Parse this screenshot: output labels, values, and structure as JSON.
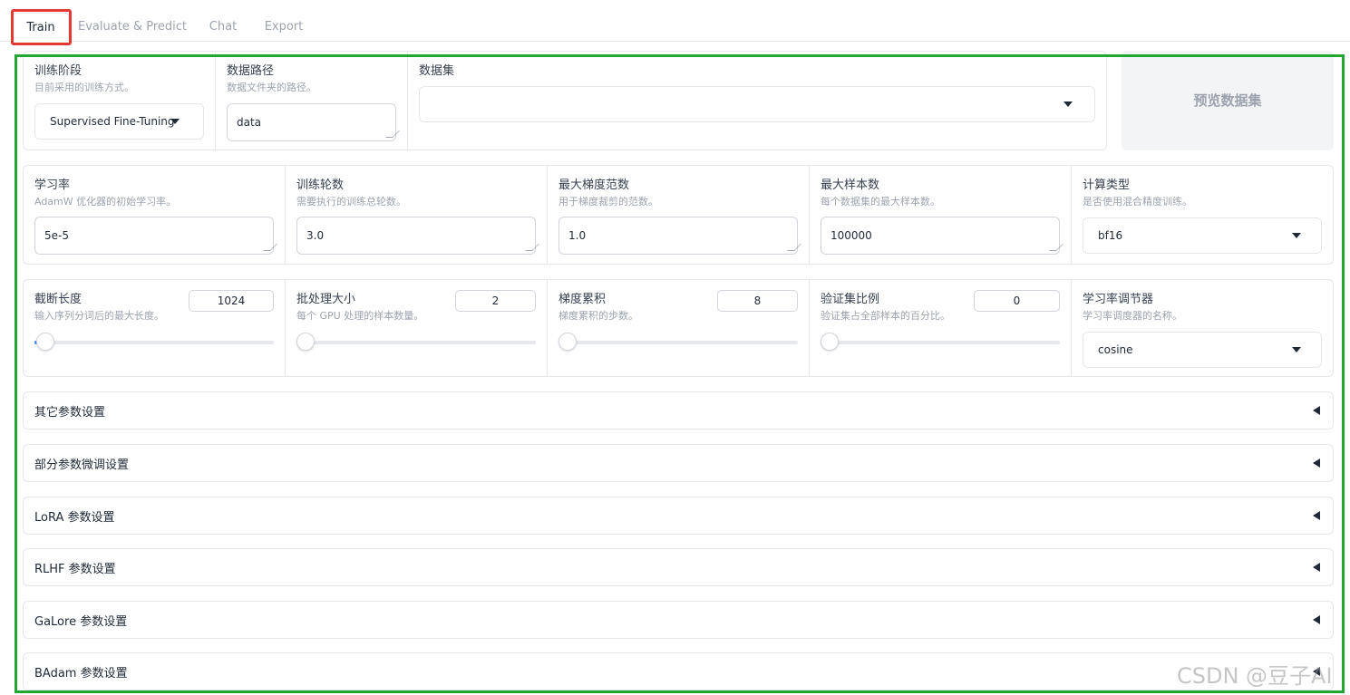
{
  "tabs": [
    "Train",
    "Evaluate & Predict",
    "Chat",
    "Export"
  ],
  "row1": {
    "stage": {
      "label": "训练阶段",
      "info": "目前采用的训练方式。",
      "value": "Supervised Fine-Tuning"
    },
    "dataset_dir": {
      "label": "数据路径",
      "info": "数据文件夹的路径。",
      "value": "data"
    },
    "dataset": {
      "label": "数据集",
      "value": ""
    },
    "preview_button": "预览数据集"
  },
  "row2": {
    "learning_rate": {
      "label": "学习率",
      "info": "AdamW 优化器的初始学习率。",
      "value": "5e-5"
    },
    "epochs": {
      "label": "训练轮数",
      "info": "需要执行的训练总轮数。",
      "value": "3.0"
    },
    "max_grad_norm": {
      "label": "最大梯度范数",
      "info": "用于梯度裁剪的范数。",
      "value": "1.0"
    },
    "max_samples": {
      "label": "最大样本数",
      "info": "每个数据集的最大样本数。",
      "value": "100000"
    },
    "compute_type": {
      "label": "计算类型",
      "info": "是否使用混合精度训练。",
      "value": "bf16"
    }
  },
  "row3": {
    "cutoff_len": {
      "label": "截断长度",
      "info": "输入序列分词后的最大长度。",
      "value": "1024"
    },
    "batch_size": {
      "label": "批处理大小",
      "info": "每个 GPU 处理的样本数量。",
      "value": "2"
    },
    "grad_accum": {
      "label": "梯度累积",
      "info": "梯度累积的步数。",
      "value": "8"
    },
    "val_size": {
      "label": "验证集比例",
      "info": "验证集占全部样本的百分比。",
      "value": "0"
    },
    "lr_scheduler": {
      "label": "学习率调节器",
      "info": "学习率调度器的名称。",
      "value": "cosine"
    }
  },
  "accordions": [
    "其它参数设置",
    "部分参数微调设置",
    "LoRA 参数设置",
    "RLHF 参数设置",
    "GaLore 参数设置",
    "BAdam 参数设置"
  ],
  "watermark": "CSDN @豆子AI",
  "colors": {
    "highlight_red": "#e53935",
    "highlight_green": "#22a832"
  }
}
